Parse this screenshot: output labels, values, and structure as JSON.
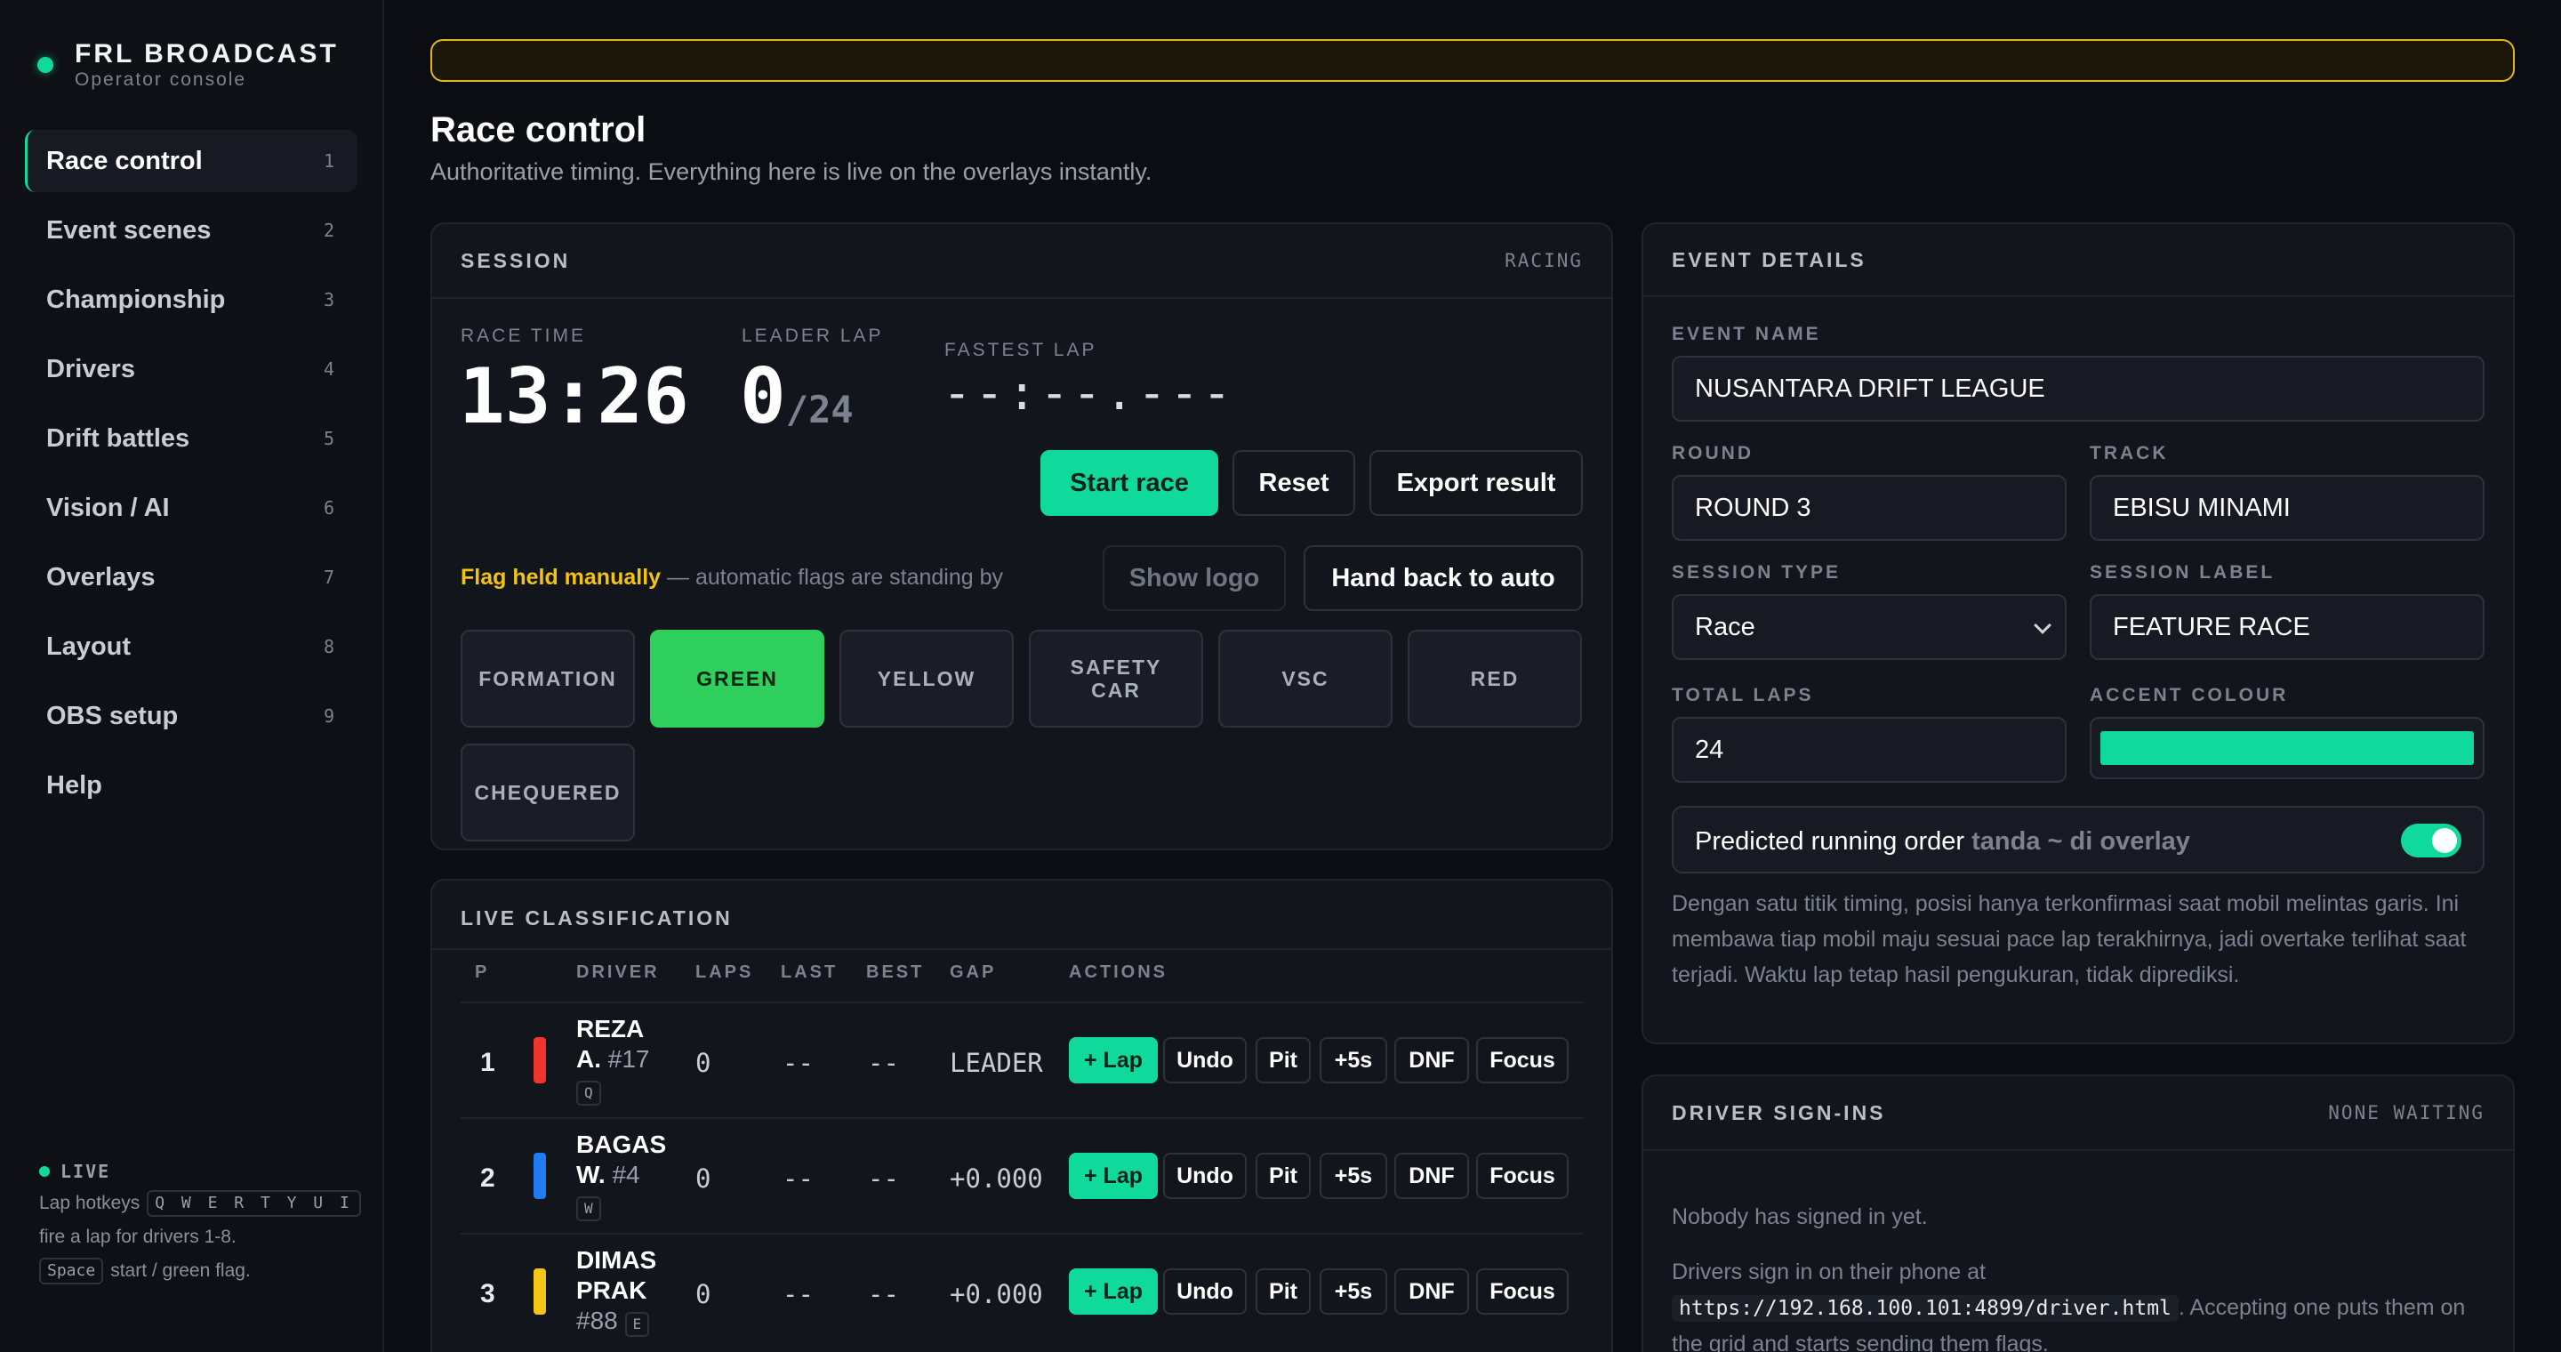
{
  "brand": {
    "title": "FRL BROADCAST",
    "subtitle": "Operator console"
  },
  "nav": [
    {
      "label": "Race control",
      "key": "1"
    },
    {
      "label": "Event scenes",
      "key": "2"
    },
    {
      "label": "Championship",
      "key": "3"
    },
    {
      "label": "Drivers",
      "key": "4"
    },
    {
      "label": "Drift battles",
      "key": "5"
    },
    {
      "label": "Vision / AI",
      "key": "6"
    },
    {
      "label": "Overlays",
      "key": "7"
    },
    {
      "label": "Layout",
      "key": "8"
    },
    {
      "label": "OBS setup",
      "key": "9"
    },
    {
      "label": "Help",
      "key": ""
    }
  ],
  "sidebar_footer": {
    "status": "LIVE",
    "hotkeys_prefix": "Lap hotkeys",
    "hotkeys": "Q W E R T Y U I",
    "hotkeys_suffix": "fire a lap for drivers 1-8.",
    "space_key": "Space",
    "space_desc": "start / green flag."
  },
  "page": {
    "title": "Race control",
    "subtitle": "Authoritative timing. Everything here is live on the overlays instantly."
  },
  "session": {
    "title": "SESSION",
    "state": "RACING",
    "race_time_label": "RACE TIME",
    "race_time": "13:26",
    "leader_lap_label": "LEADER LAP",
    "leader_lap": "0",
    "total_laps": "/24",
    "fastest_lap_label": "FASTEST LAP",
    "fastest_lap": "--:--.---",
    "start_label": "Start race",
    "reset_label": "Reset",
    "export_label": "Export result",
    "flag_held": "Flag held manually",
    "flag_note": " — automatic flags are standing by",
    "show_logo_label": "Show logo",
    "hand_back_label": "Hand back to auto",
    "flags": {
      "formation": "FORMATION",
      "green": "GREEN",
      "yellow": "YELLOW",
      "safety_1": "SAFETY",
      "safety_2": "CAR",
      "vsc": "VSC",
      "red": "RED",
      "chequered": "CHEQUERED"
    },
    "active_flag": "GREEN"
  },
  "classification": {
    "title": "LIVE CLASSIFICATION",
    "headers": {
      "p": "P",
      "driver": "DRIVER",
      "laps": "LAPS",
      "last": "LAST",
      "best": "BEST",
      "gap": "GAP",
      "actions": "ACTIONS"
    },
    "actions": {
      "lap": "+ Lap",
      "undo": "Undo",
      "pit": "Pit",
      "pen": "+5s",
      "dnf": "DNF",
      "focus": "Focus"
    },
    "rows": [
      {
        "pos": "1",
        "color": "#f0352f",
        "name_1": "REZA",
        "name_2": "A.",
        "num": "#17",
        "key": "Q",
        "laps": "0",
        "last": "--",
        "best": "--",
        "gap": "LEADER"
      },
      {
        "pos": "2",
        "color": "#1f7cf2",
        "name_1": "BAGAS",
        "name_2": "W.",
        "num": "#4",
        "key": "W",
        "laps": "0",
        "last": "--",
        "best": "--",
        "gap": "+0.000"
      },
      {
        "pos": "3",
        "color": "#f5c518",
        "name_1": "DIMAS",
        "name_2": "PRAK",
        "num": "#88",
        "key": "E",
        "laps": "0",
        "last": "--",
        "best": "--",
        "gap": "+0.000"
      }
    ]
  },
  "event": {
    "title": "EVENT DETAILS",
    "name_label": "EVENT NAME",
    "name": "NUSANTARA DRIFT LEAGUE",
    "round_label": "ROUND",
    "round": "ROUND 3",
    "track_label": "TRACK",
    "track": "EBISU MINAMI",
    "session_type_label": "SESSION TYPE",
    "session_type": "Race",
    "session_label_label": "SESSION LABEL",
    "session_label": "FEATURE RACE",
    "total_laps_label": "TOTAL LAPS",
    "total_laps": "24",
    "accent_label": "ACCENT COLOUR",
    "accent": "#10d99c",
    "predicted_label": "Predicted running order",
    "predicted_hint": "tanda ~ di overlay",
    "predicted_on": true,
    "predicted_desc": "Dengan satu titik timing, posisi hanya terkonfirmasi saat mobil melintas garis. Ini membawa tiap mobil maju sesuai pace lap terakhirnya, jadi overtake terlihat saat terjadi. Waktu lap tetap hasil pengukuran, tidak diprediksi."
  },
  "signins": {
    "title": "DRIVER SIGN-INS",
    "state": "NONE WAITING",
    "empty": "Nobody has signed in yet.",
    "info_prefix": "Drivers sign in on their phone at",
    "url": "https://192.168.100.101:4899/driver.html",
    "info_suffix": ". Accepting one puts them on the grid and starts sending them flags."
  }
}
